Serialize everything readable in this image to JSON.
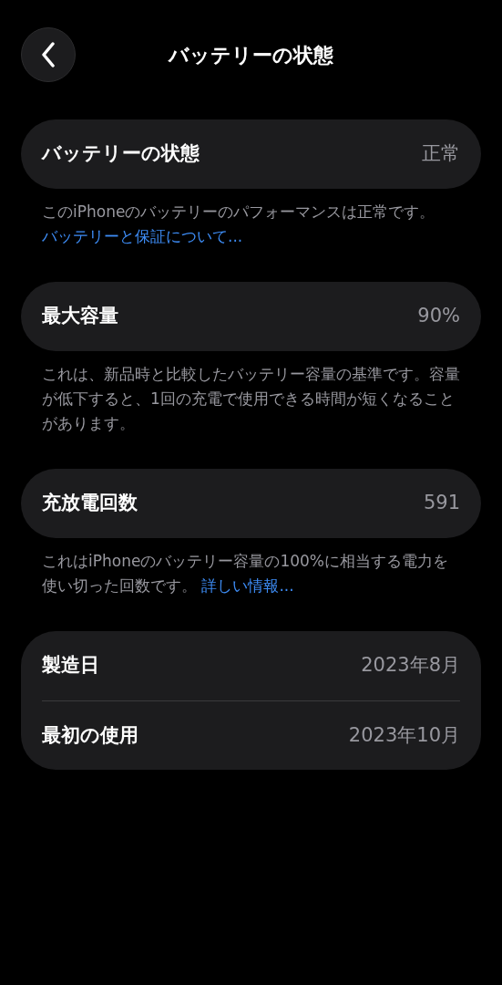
{
  "header": {
    "title": "バッテリーの状態"
  },
  "sections": [
    {
      "rows": [
        {
          "label": "バッテリーの状態",
          "value": "正常"
        }
      ],
      "footer": {
        "text": "このiPhoneのバッテリーのパフォーマンスは正常です。",
        "link": "バッテリーと保証について..."
      }
    },
    {
      "rows": [
        {
          "label": "最大容量",
          "value": "90%"
        }
      ],
      "footer": {
        "text": "これは、新品時と比較したバッテリー容量の基準です。容量が低下すると、1回の充電で使用できる時間が短くなることがあります。"
      }
    },
    {
      "rows": [
        {
          "label": "充放電回数",
          "value": "591"
        }
      ],
      "footer": {
        "text": "これはiPhoneのバッテリー容量の100%に相当する電力を使い切った回数です。 ",
        "link": "詳しい情報..."
      }
    },
    {
      "rows": [
        {
          "label": "製造日",
          "value": "2023年8月"
        },
        {
          "label": "最初の使用",
          "value": "2023年10月"
        }
      ]
    }
  ]
}
